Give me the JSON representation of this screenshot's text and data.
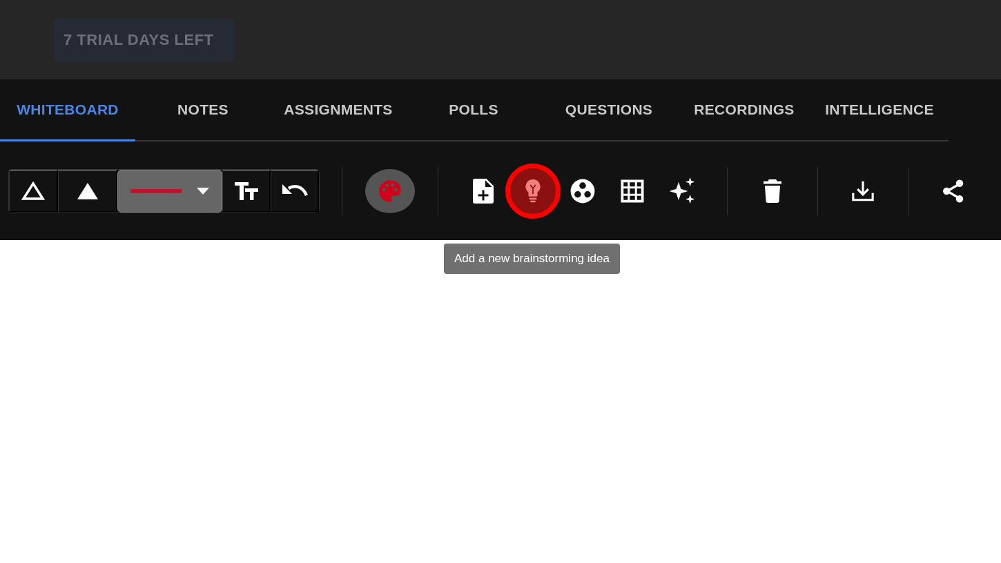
{
  "trial_badge": "7 TRIAL DAYS LEFT",
  "tabs": [
    {
      "label": "WHITEBOARD",
      "selected": true
    },
    {
      "label": "NOTES",
      "selected": false
    },
    {
      "label": "ASSIGNMENTS",
      "selected": false
    },
    {
      "label": "POLLS",
      "selected": false
    },
    {
      "label": "QUESTIONS",
      "selected": false
    },
    {
      "label": "RECORDINGS",
      "selected": false
    },
    {
      "label": "INTELLIGENCE",
      "selected": false
    }
  ],
  "segments": [
    {
      "kind": "triangle-outline",
      "selected": false
    },
    {
      "kind": "triangle-filled",
      "selected": false
    },
    {
      "kind": "line-color",
      "selected": true
    },
    {
      "kind": "text-size",
      "selected": false
    },
    {
      "kind": "undo",
      "selected": false
    }
  ],
  "sections": [
    [
      {
        "kind": "palette",
        "highlighted": false
      }
    ],
    [
      {
        "kind": "add-page",
        "highlighted": false
      },
      {
        "kind": "idea",
        "highlighted": true
      },
      {
        "kind": "circles",
        "highlighted": false
      },
      {
        "kind": "grid",
        "highlighted": false
      },
      {
        "kind": "sparkles",
        "highlighted": false
      }
    ],
    [
      {
        "kind": "trash",
        "highlighted": false
      }
    ],
    [
      {
        "kind": "download",
        "highlighted": false
      }
    ],
    [
      {
        "kind": "share",
        "highlighted": false
      }
    ]
  ],
  "tooltip": "Add a new brainstorming idea"
}
